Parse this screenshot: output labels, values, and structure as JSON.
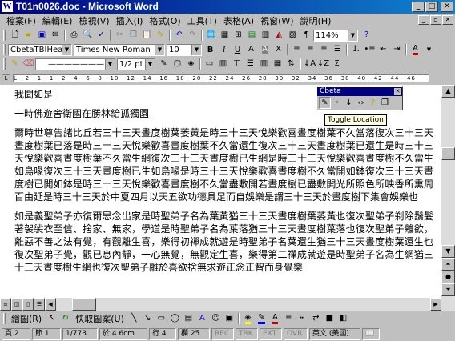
{
  "window": {
    "title": "T01n0026.doc - Microsoft Word",
    "app_icon": "word-icon",
    "buttons": [
      "minimize",
      "maximize",
      "close"
    ]
  },
  "menubar": {
    "items": [
      "檔案(F)",
      "編輯(E)",
      "檢視(V)",
      "插入(I)",
      "格式(O)",
      "工具(T)",
      "表格(A)",
      "視窗(W)",
      "說明(H)"
    ]
  },
  "toolbar_standard": {
    "zoom": "114%",
    "icons": [
      "new-icon",
      "open-icon",
      "save-icon",
      "email-icon",
      "print-icon",
      "print-preview-icon",
      "spelling-icon",
      "cut-icon",
      "copy-icon",
      "paste-icon",
      "format-painter-icon",
      "undo-icon",
      "redo-icon",
      "hyperlink-icon",
      "tables-borders-icon",
      "insert-table-icon",
      "excel-icon",
      "columns-icon",
      "drawing-icon",
      "doc-map-icon",
      "show-hide-icon",
      "help-icon"
    ]
  },
  "toolbar_formatting": {
    "style": "CbetaTBIHeac",
    "font": "Times New Roman",
    "size": "10",
    "bold": "B",
    "italic": "I",
    "underline": "U"
  },
  "toolbar_tables": {
    "line_weight": "1/2 pt"
  },
  "ruler": {
    "ticks": "L · 2 · 1 · 1 · 2 · 4 · 6 · 8 · 10 · 12 · 14 · 16 · 18 · 20 · 22 · 24 · 26 · 28 · 30 · 32 · 34 · 36 · 38 · 40 · 42 · 44 · 46"
  },
  "document": {
    "paragraphs": [
      "我聞如是",
      "一時佛遊舍衛國在勝林給孤獨園",
      "爾時世尊告諸比丘若三十三天晝度樹葉萎黃是時三十三天悅樂歡喜晝度樹葉不久當落復次三十三天晝度樹葉已落是時三十三天悅樂歡喜晝度樹葉不久當還生復次三十三天晝度樹葉已還生是時三十三天悅樂歡喜晝度樹葉不久當生網復次三十三天晝度樹已生網是時三十三天悅樂歡喜晝度樹不久當生如鳥喙復次三十三天晝度樹已生如鳥喙是時三十三天悅樂歡喜晝度樹不久當開如鉢復次三十三天晝度樹已開如鉢是時三十三天悅樂歡喜晝度樹不久當盡敷開若晝度樹已盡敷開光所照色所映香所熏周百由延是時三十三天於中夏四月以天五欲功德具足而自娛樂是謂三十三天於晝度樹下集會娛樂也",
      "如是義聖弟子亦復爾思念出家是時聖弟子名為葉黃猶三十三天晝度樹葉萎黃也復次聖弟子剃除鬚髮著袈裟衣至信、捨家、無家，學道是時聖弟子名為葉落猶三十三天晝度樹葉落也復次聖弟子離欲，離惡不善之法有覺，有觀離生喜，樂得初禪成就遊是時聖弟子名葉還生猶三十三天晝度樹葉還生也復次聖弟子覺，觀已息內靜，一心無覺，無觀定生喜，樂得第二禪成就遊是時聖弟子名為生網猶三十三天晝度樹生網也復次聖弟子離於喜欲捨無求遊正念正智而身覺樂"
    ]
  },
  "cbeta_toolbar": {
    "title": "Cbeta",
    "tooltip": "Toggle Location",
    "icons": [
      "toggle-location-icon",
      "dot-icon",
      "down-arrow-icon",
      "angle-brackets-icon",
      "help-question-icon",
      "copy-pages-icon"
    ]
  },
  "drawbar": {
    "draw": "繪圖(R)",
    "autoshapes": "快取圖案(U)"
  },
  "statusbar": {
    "page": "頁 2",
    "section": "節 1",
    "pages": "1/773",
    "position": "於 4.6cm",
    "line": "行 4",
    "column": "欄 25",
    "rec": "REC",
    "trk": "TRK",
    "ext": "EXT",
    "ovr": "OVR",
    "language": "英文 (美國)"
  },
  "colors": {
    "titlebar_start": "#000080",
    "titlebar_end": "#1084d0",
    "chrome": "#c0c0c0",
    "tooltip_bg": "#ffffe1"
  }
}
